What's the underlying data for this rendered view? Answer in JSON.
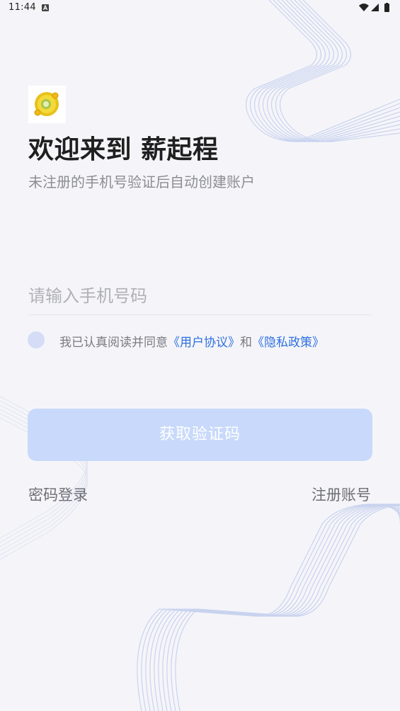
{
  "status_bar": {
    "time": "11:44"
  },
  "header": {
    "title": "欢迎来到 薪起程",
    "subtitle": "未注册的手机号验证后自动创建账户"
  },
  "login_form": {
    "phone_placeholder": "请输入手机号码",
    "phone_value": "",
    "agreement": {
      "prefix": "我已认真阅读并同意",
      "user_agreement": "《用户协议》",
      "connector": "和",
      "privacy_policy": "《隐私政策》",
      "checked": false
    },
    "get_code_button": "获取验证码",
    "password_login": "密码登录",
    "register_account": "注册账号"
  },
  "colors": {
    "background": "#f5f5f9",
    "accent_link": "#2e6fe0",
    "button_disabled": "#c8d9fb",
    "deco_lines": "#c9d3ef"
  },
  "icons": {
    "app_logo": "yellow-disc-logo",
    "status_a": "a-notification-icon",
    "wifi": "wifi-icon",
    "signal": "signal-icon",
    "battery": "battery-icon"
  }
}
